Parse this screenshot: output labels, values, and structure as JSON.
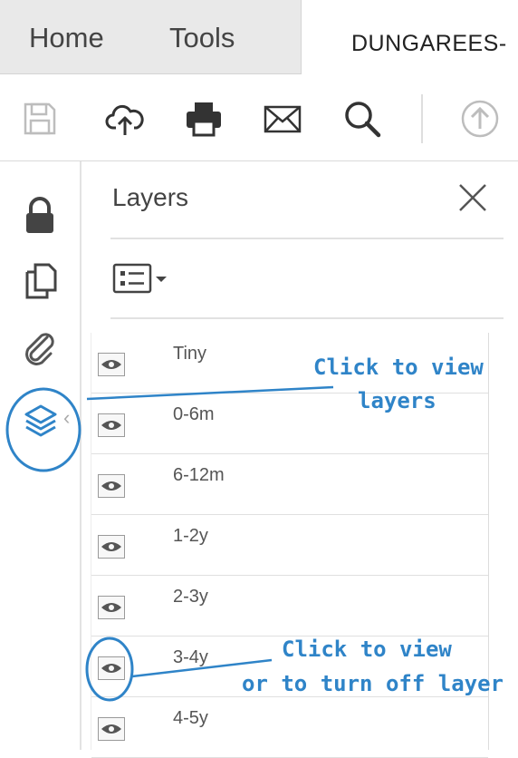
{
  "tabs": {
    "home": "Home",
    "tools": "Tools",
    "document": "DUNGAREES-"
  },
  "toolbar": {
    "icons": [
      "save-icon",
      "cloud-upload-icon",
      "print-icon",
      "email-icon",
      "search-icon",
      "share-icon"
    ]
  },
  "rail": {
    "icons": [
      "lock-icon",
      "pages-icon",
      "attachment-icon",
      "layers-icon"
    ]
  },
  "panel": {
    "title": "Layers",
    "close_icon": "close-icon",
    "options_icon": "options-menu-icon"
  },
  "layers": [
    {
      "name": "Tiny"
    },
    {
      "name": "0-6m"
    },
    {
      "name": "6-12m"
    },
    {
      "name": "1-2y"
    },
    {
      "name": "2-3y"
    },
    {
      "name": "3-4y"
    },
    {
      "name": "4-5y"
    }
  ],
  "annotations": {
    "view_line1": "Click to view",
    "view_line2": "layers",
    "toggle_line1": "Click to view",
    "toggle_line2": "or to turn off layer"
  },
  "colors": {
    "annotation": "#2f84c8",
    "tab_bg": "#e9e9e9",
    "icon": "#333333"
  }
}
